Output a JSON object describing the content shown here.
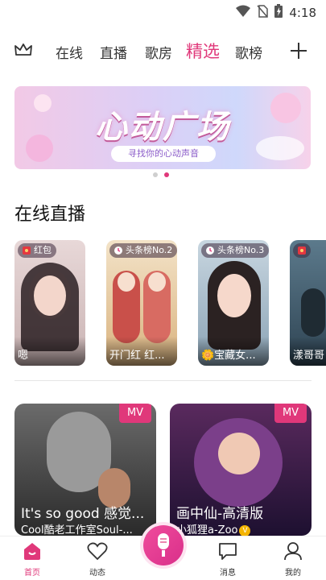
{
  "status_bar": {
    "time": "4:18",
    "icons": [
      "wifi-icon",
      "sim-off-icon",
      "battery-icon"
    ]
  },
  "top_nav": {
    "tabs": [
      {
        "label": "在线",
        "active": false
      },
      {
        "label": "直播",
        "active": false
      },
      {
        "label": "歌房",
        "active": false
      },
      {
        "label": "精选",
        "active": true
      },
      {
        "label": "歌榜",
        "active": false
      }
    ],
    "icons": [
      "crown-icon",
      "plus-icon"
    ]
  },
  "banner": {
    "title": "心动广场",
    "subtitle": "寻找你的心动声音",
    "page_count": 2,
    "current_page": 2
  },
  "live_section": {
    "title": "在线直播",
    "cards": [
      {
        "badge": "红包",
        "caption": "嗯"
      },
      {
        "badge": "头条榜No.2",
        "caption": "开门红 红..."
      },
      {
        "badge": "头条榜No.3",
        "caption": "🌼宝藏女..."
      },
      {
        "badge": "",
        "caption": "漾哥哥"
      }
    ]
  },
  "mv_section": {
    "cards": [
      {
        "badge": "MV",
        "title": "It's so good 感觉...",
        "subtitle": "Cool酷老工作室Soul-..."
      },
      {
        "badge": "MV",
        "title": "画中仙-高清版",
        "subtitle": "小狐狸a-Zoo",
        "verified": "V"
      }
    ]
  },
  "bottom_nav": {
    "items": [
      {
        "label": "首页",
        "icon": "home-icon",
        "active": true
      },
      {
        "label": "动态",
        "icon": "heart-icon",
        "active": false
      },
      {
        "label": "",
        "icon": "microphone-icon",
        "active": false
      },
      {
        "label": "消息",
        "icon": "message-icon",
        "active": false
      },
      {
        "label": "我的",
        "icon": "profile-icon",
        "active": false
      }
    ]
  },
  "colors": {
    "accent": "#e0387a",
    "text": "#222222",
    "badge_verified": "#f4b400"
  }
}
